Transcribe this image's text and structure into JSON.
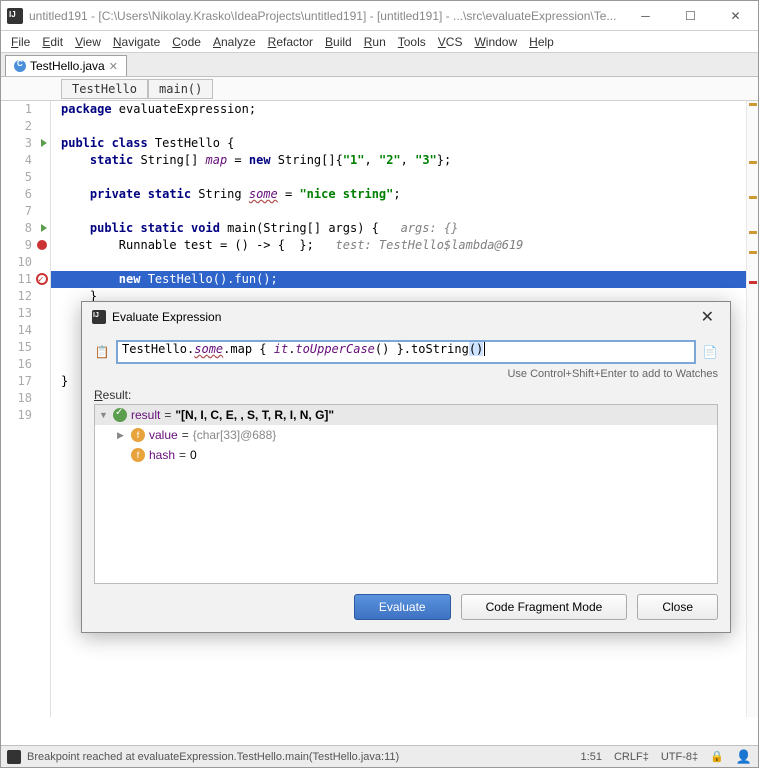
{
  "window": {
    "title": "untitled191 - [C:\\Users\\Nikolay.Krasko\\IdeaProjects\\untitled191] - [untitled191] - ...\\src\\evaluateExpression\\Te..."
  },
  "menu": [
    "File",
    "Edit",
    "View",
    "Navigate",
    "Code",
    "Analyze",
    "Refactor",
    "Build",
    "Run",
    "Tools",
    "VCS",
    "Window",
    "Help"
  ],
  "tab": {
    "name": "TestHello.java"
  },
  "breadcrumbs": [
    "TestHello",
    "main()"
  ],
  "code_lines": [
    {
      "n": 1,
      "html": "<span class='kw'>package</span> evaluateExpression;"
    },
    {
      "n": 2,
      "html": ""
    },
    {
      "n": 3,
      "html": "<span class='kw'>public class</span> TestHello {",
      "run": true
    },
    {
      "n": 4,
      "html": "    <span class='kw'>static</span> String[] <span class='field'>map</span> = <span class='kw'>new</span> String[]{<span class='str'>\"1\"</span>, <span class='str'>\"2\"</span>, <span class='str'>\"3\"</span>};"
    },
    {
      "n": 5,
      "html": ""
    },
    {
      "n": 6,
      "html": "    <span class='kw'>private static</span> String <span class='field field-u'>some</span> = <span class='str'>\"nice string\"</span>;"
    },
    {
      "n": 7,
      "html": ""
    },
    {
      "n": 8,
      "html": "    <span class='kw'>public static void</span> main(String[] args) {   <span class='cmt'>args: {}</span>",
      "run": true
    },
    {
      "n": 9,
      "html": "        Runnable test = () -> {  };   <span class='cmt'>test: TestHello$lambda@619</span>",
      "bp": true
    },
    {
      "n": 10,
      "html": ""
    },
    {
      "n": 11,
      "html": "        <span class='kw'>new</span> TestHello().fun();",
      "hl": true,
      "bpc": true
    },
    {
      "n": 12,
      "html": "    }"
    },
    {
      "n": 13,
      "html": ""
    },
    {
      "n": 14,
      "html": ""
    },
    {
      "n": 15,
      "html": ""
    },
    {
      "n": 16,
      "html": ""
    },
    {
      "n": 17,
      "html": "}"
    },
    {
      "n": 18,
      "html": ""
    },
    {
      "n": 19,
      "html": ""
    }
  ],
  "dialog": {
    "title": "Evaluate Expression",
    "expression_html": "TestHello.<span class='field' style='text-decoration:underline wavy #b05252'>some</span>.map { <span class='field'>it</span>.<span class='field'>toUpperCase</span>() }.toString<span class='sel'>()</span>",
    "hint": "Use Control+Shift+Enter to add to Watches",
    "result_label": "Result:",
    "tree": {
      "root": {
        "name": "result",
        "value": "\"[N, I, C, E,  , S, T, R, I, N, G]\""
      },
      "children": [
        {
          "name": "value",
          "value": "{char[33]@688}",
          "gray": true
        },
        {
          "name": "hash",
          "value": "0"
        }
      ]
    },
    "buttons": {
      "evaluate": "Evaluate",
      "fragment": "Code Fragment Mode",
      "close": "Close"
    }
  },
  "status": {
    "text": "Breakpoint reached at evaluateExpression.TestHello.main(TestHello.java:11)",
    "pos": "1:51",
    "eol": "CRLF",
    "enc": "UTF-8"
  }
}
